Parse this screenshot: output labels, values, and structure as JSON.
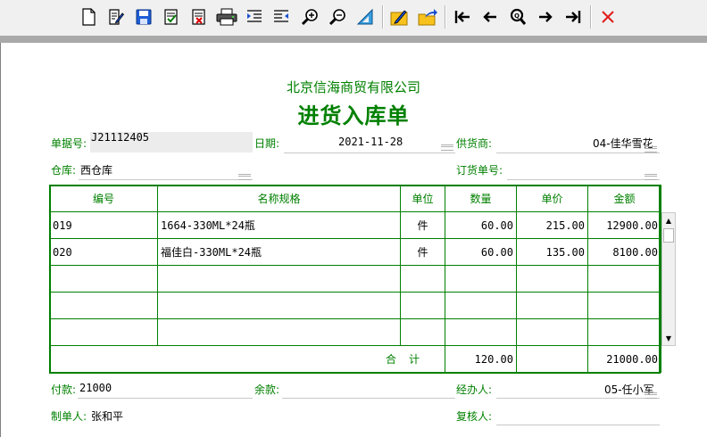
{
  "toolbar": {
    "buttons": [
      {
        "name": "new-icon"
      },
      {
        "name": "edit-icon"
      },
      {
        "name": "save-icon"
      },
      {
        "name": "approve-icon"
      },
      {
        "name": "unapprove-icon"
      },
      {
        "name": "print-icon"
      },
      {
        "name": "indent-icon"
      },
      {
        "name": "outdent-icon"
      },
      {
        "name": "zoom-in-icon"
      },
      {
        "name": "zoom-out-icon"
      },
      {
        "name": "setsquare-icon"
      },
      {
        "name": "pen-icon"
      },
      {
        "name": "export-icon"
      },
      {
        "name": "first-record-icon"
      },
      {
        "name": "prev-record-icon"
      },
      {
        "name": "find-icon"
      },
      {
        "name": "next-record-icon"
      },
      {
        "name": "last-record-icon"
      },
      {
        "name": "close-icon"
      }
    ]
  },
  "header": {
    "company": "北京信海商贸有限公司",
    "title": "进货入库单"
  },
  "fields": {
    "doc_no_label": "单据号:",
    "doc_no": "J21112405",
    "date_label": "日期:",
    "date": "2021-11-28",
    "supplier_label": "供货商:",
    "supplier": "04-佳华雪花",
    "warehouse_label": "仓库:",
    "warehouse": "西仓库",
    "order_no_label": "订货单号:",
    "order_no": ""
  },
  "table": {
    "columns": [
      "编号",
      "名称规格",
      "单位",
      "数量",
      "单价",
      "金额"
    ],
    "rows": [
      {
        "code": "019",
        "name": "1664-330ML*24瓶",
        "unit": "件",
        "qty": "60.00",
        "price": "215.00",
        "amount": "12900.00"
      },
      {
        "code": "020",
        "name": "福佳白-330ML*24瓶",
        "unit": "件",
        "qty": "60.00",
        "price": "135.00",
        "amount": "8100.00"
      }
    ],
    "total_label": "合计",
    "total_qty": "120.00",
    "total_amount": "21000.00"
  },
  "footer": {
    "paid_label": "付款:",
    "paid": "21000",
    "balance_label": "余款:",
    "balance": "",
    "handler_label": "经办人:",
    "handler": "05-任小军",
    "maker_label": "制单人:",
    "maker": "张和平",
    "reviewer_label": "复核人:",
    "reviewer": ""
  },
  "colors": {
    "accent": "#008000",
    "toolbar_bg": "#f0f0f0",
    "band": "#a9a9a9"
  }
}
